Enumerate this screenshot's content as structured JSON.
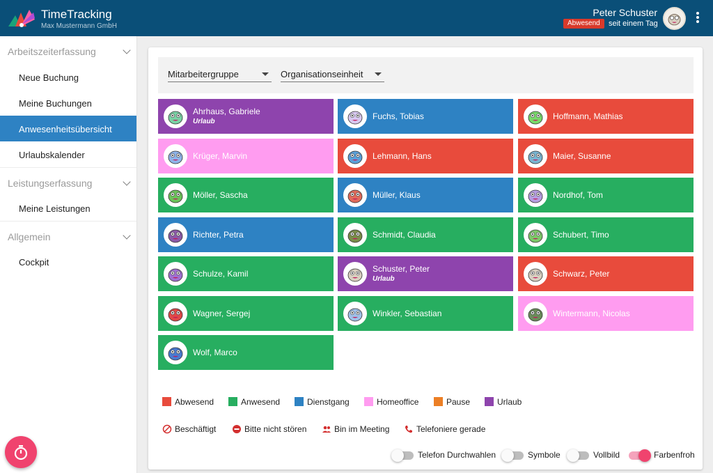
{
  "header": {
    "app_title": "TimeTracking",
    "company": "Max Mustermann GmbH",
    "user_name": "Peter Schuster",
    "status": "Abwesend",
    "status_since": "seit einem Tag"
  },
  "sidebar": {
    "sections": [
      {
        "label": "Arbeitszeiterfassung",
        "items": [
          "Neue Buchung",
          "Meine Buchungen",
          "Anwesenheitsübersicht",
          "Urlaubskalender"
        ]
      },
      {
        "label": "Leistungserfassung",
        "items": [
          "Meine Leistungen"
        ]
      },
      {
        "label": "Allgemein",
        "items": [
          "Cockpit"
        ]
      }
    ],
    "active_item": "Anwesenheitsübersicht"
  },
  "filters": {
    "group": "Mitarbeitergruppe",
    "unit": "Organisationseinheit"
  },
  "colors": {
    "header": "#0a4f78",
    "Abwesend": "#e84b3c",
    "Anwesend": "#27ae60",
    "Dienstgang": "#2e82c3",
    "Homeoffice": "#ff9cf0",
    "Pause": "#ec7f25",
    "Urlaub": "#8e44ad",
    "accent": "#f0436e"
  },
  "employees": [
    {
      "name": "Ahrhaus, Gabriele",
      "status": "Urlaub",
      "sub": "Urlaub"
    },
    {
      "name": "Fuchs, Tobias",
      "status": "Dienstgang"
    },
    {
      "name": "Hoffmann, Mathias",
      "status": "Abwesend"
    },
    {
      "name": "Krüger, Marvin",
      "status": "Homeoffice"
    },
    {
      "name": "Lehmann, Hans",
      "status": "Abwesend"
    },
    {
      "name": "Maier, Susanne",
      "status": "Abwesend"
    },
    {
      "name": "Möller, Sascha",
      "status": "Anwesend"
    },
    {
      "name": "Müller, Klaus",
      "status": "Dienstgang"
    },
    {
      "name": "Nordhof, Tom",
      "status": "Anwesend"
    },
    {
      "name": "Richter, Petra",
      "status": "Dienstgang"
    },
    {
      "name": "Schmidt, Claudia",
      "status": "Anwesend"
    },
    {
      "name": "Schubert, Timo",
      "status": "Anwesend"
    },
    {
      "name": "Schulze, Kamil",
      "status": "Anwesend"
    },
    {
      "name": "Schuster, Peter",
      "status": "Urlaub",
      "sub": "Urlaub"
    },
    {
      "name": "Schwarz, Peter",
      "status": "Abwesend"
    },
    {
      "name": "Wagner, Sergej",
      "status": "Anwesend"
    },
    {
      "name": "Winkler, Sebastian",
      "status": "Anwesend"
    },
    {
      "name": "Wintermann, Nicolas",
      "status": "Homeoffice"
    },
    {
      "name": "Wolf, Marco",
      "status": "Anwesend"
    }
  ],
  "legend": [
    "Abwesend",
    "Anwesend",
    "Dienstgang",
    "Homeoffice",
    "Pause",
    "Urlaub"
  ],
  "statuses": [
    {
      "label": "Beschäftigt",
      "icon": "block-icon"
    },
    {
      "label": "Bitte nicht stören",
      "icon": "do-not-disturb-icon"
    },
    {
      "label": "Bin im Meeting",
      "icon": "people-icon"
    },
    {
      "label": "Telefoniere gerade",
      "icon": "phone-icon"
    }
  ],
  "toggles": [
    {
      "label": "Telefon Durchwahlen",
      "on": false
    },
    {
      "label": "Symbole",
      "on": false
    },
    {
      "label": "Vollbild",
      "on": false
    },
    {
      "label": "Farbenfroh",
      "on": true
    }
  ],
  "fab_icon": "stopwatch-icon"
}
